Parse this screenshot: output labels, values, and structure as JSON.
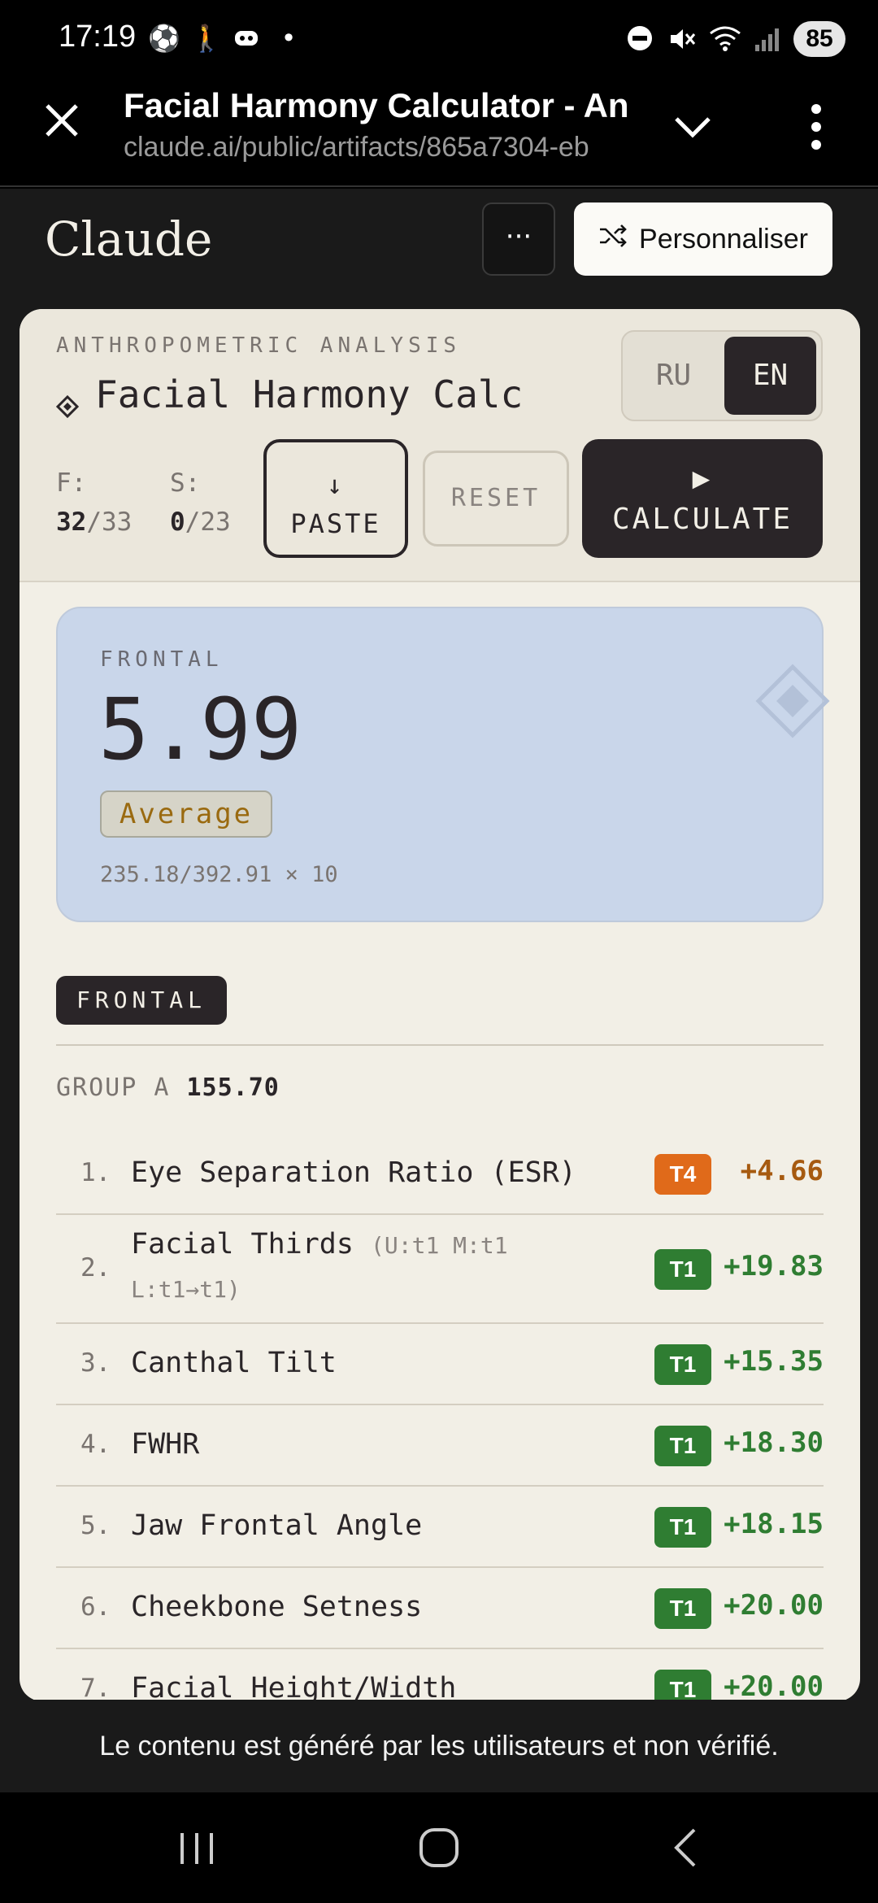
{
  "status": {
    "time": "17:19",
    "left_icons": [
      "soccer-icon",
      "walk-icon",
      "discord-icon",
      "dot-icon"
    ],
    "battery": "85"
  },
  "browser": {
    "title": "Facial Harmony Calculator - Anthropometric",
    "url": "claude.ai/public/artifacts/865a7304-eb"
  },
  "claude": {
    "logo": "Claude",
    "more_label": "···",
    "customize_label": "Personnaliser"
  },
  "app": {
    "eyebrow": "ANTHROPOMETRIC ANALYSIS",
    "title": "Facial Harmony Calc",
    "lang_ru": "RU",
    "lang_en": "EN",
    "frontal_label": "F:",
    "frontal_count": "32",
    "frontal_total": "/33",
    "side_label": "S:",
    "side_count": "0",
    "side_total": "/23",
    "paste_icon": "↓",
    "paste_label": "PASTE",
    "reset_label": "RESET",
    "calc_icon": "▶",
    "calc_label": "CALCULATE"
  },
  "score": {
    "label": "FRONTAL",
    "value": "5.99",
    "badge": "Average",
    "formula": "235.18/392.91 × 10"
  },
  "section": {
    "tag": "FRONTAL",
    "group_label": "GROUP A",
    "group_value": "155.70"
  },
  "rows": [
    {
      "num": "1.",
      "name": "Eye Separation Ratio (ESR)",
      "sub": "",
      "tier": "T4",
      "delta": "+4.66"
    },
    {
      "num": "2.",
      "name": "Facial Thirds",
      "sub": "(U:t1 M:t1 L:t1→t1)",
      "tier": "T1",
      "delta": "+19.83"
    },
    {
      "num": "3.",
      "name": "Canthal Tilt",
      "sub": "",
      "tier": "T1",
      "delta": "+15.35"
    },
    {
      "num": "4.",
      "name": "FWHR",
      "sub": "",
      "tier": "T1",
      "delta": "+18.30"
    },
    {
      "num": "5.",
      "name": "Jaw Frontal Angle",
      "sub": "",
      "tier": "T1",
      "delta": "+18.15"
    },
    {
      "num": "6.",
      "name": "Cheekbone Setness",
      "sub": "",
      "tier": "T1",
      "delta": "+20.00"
    },
    {
      "num": "7.",
      "name": "Facial Height/Width",
      "sub": "",
      "tier": "T1",
      "delta": "+20.00"
    }
  ],
  "footer_note": "Le contenu est généré par les utilisateurs et non vérifié.",
  "colors": {
    "tier_t1": "#2f7d32",
    "tier_t4": "#e06a1a",
    "score_panel": "#c9d6ea",
    "badge_text": "#9a6a10"
  }
}
